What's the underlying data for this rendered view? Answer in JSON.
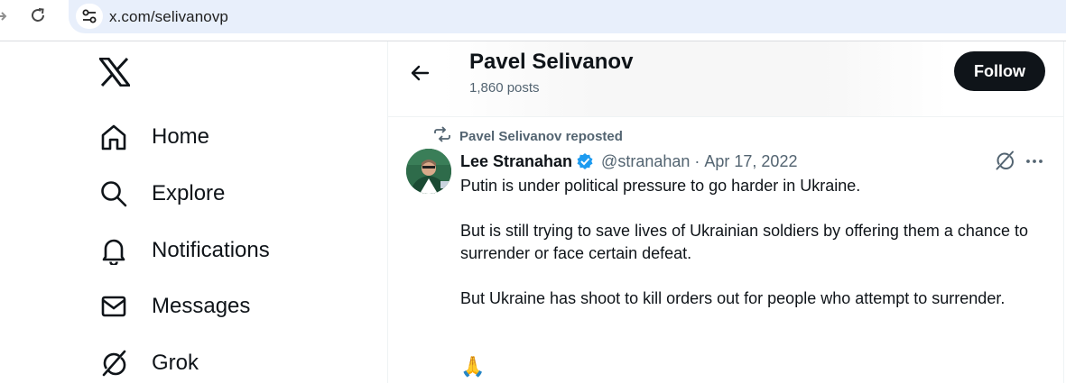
{
  "browser": {
    "url": "x.com/selivanovp",
    "icons": {
      "forward": "forward-arrow-icon",
      "reload": "reload-icon",
      "site_info": "site-settings-icon"
    }
  },
  "sidebar": {
    "logo": "x-logo-icon",
    "items": [
      {
        "label": "Home",
        "icon": "home-icon"
      },
      {
        "label": "Explore",
        "icon": "search-icon"
      },
      {
        "label": "Notifications",
        "icon": "bell-icon"
      },
      {
        "label": "Messages",
        "icon": "envelope-icon"
      },
      {
        "label": "Grok",
        "icon": "grok-icon"
      }
    ]
  },
  "header": {
    "name": "Pavel Selivanov",
    "posts": "1,860 posts",
    "follow_label": "Follow"
  },
  "tweet": {
    "repost_label": "Pavel Selivanov reposted",
    "author": "Lee Stranahan",
    "handle": "@stranahan",
    "separator": "·",
    "date": "Apr 17, 2022",
    "paragraphs": [
      "Putin is under political pressure to go harder in Ukraine.",
      "But is still trying to save lives of Ukrainian soldiers by offering them a chance to surrender or  face certain defeat.",
      "But Ukraine has shoot to kill orders out for people who attempt to surrender."
    ],
    "emoji": "🙏"
  },
  "colors": {
    "text": "#0f1419",
    "secondary": "#536471",
    "verified": "#1d9bf0",
    "follow_bg": "#0f1419",
    "omnibox": "#e8effb"
  }
}
